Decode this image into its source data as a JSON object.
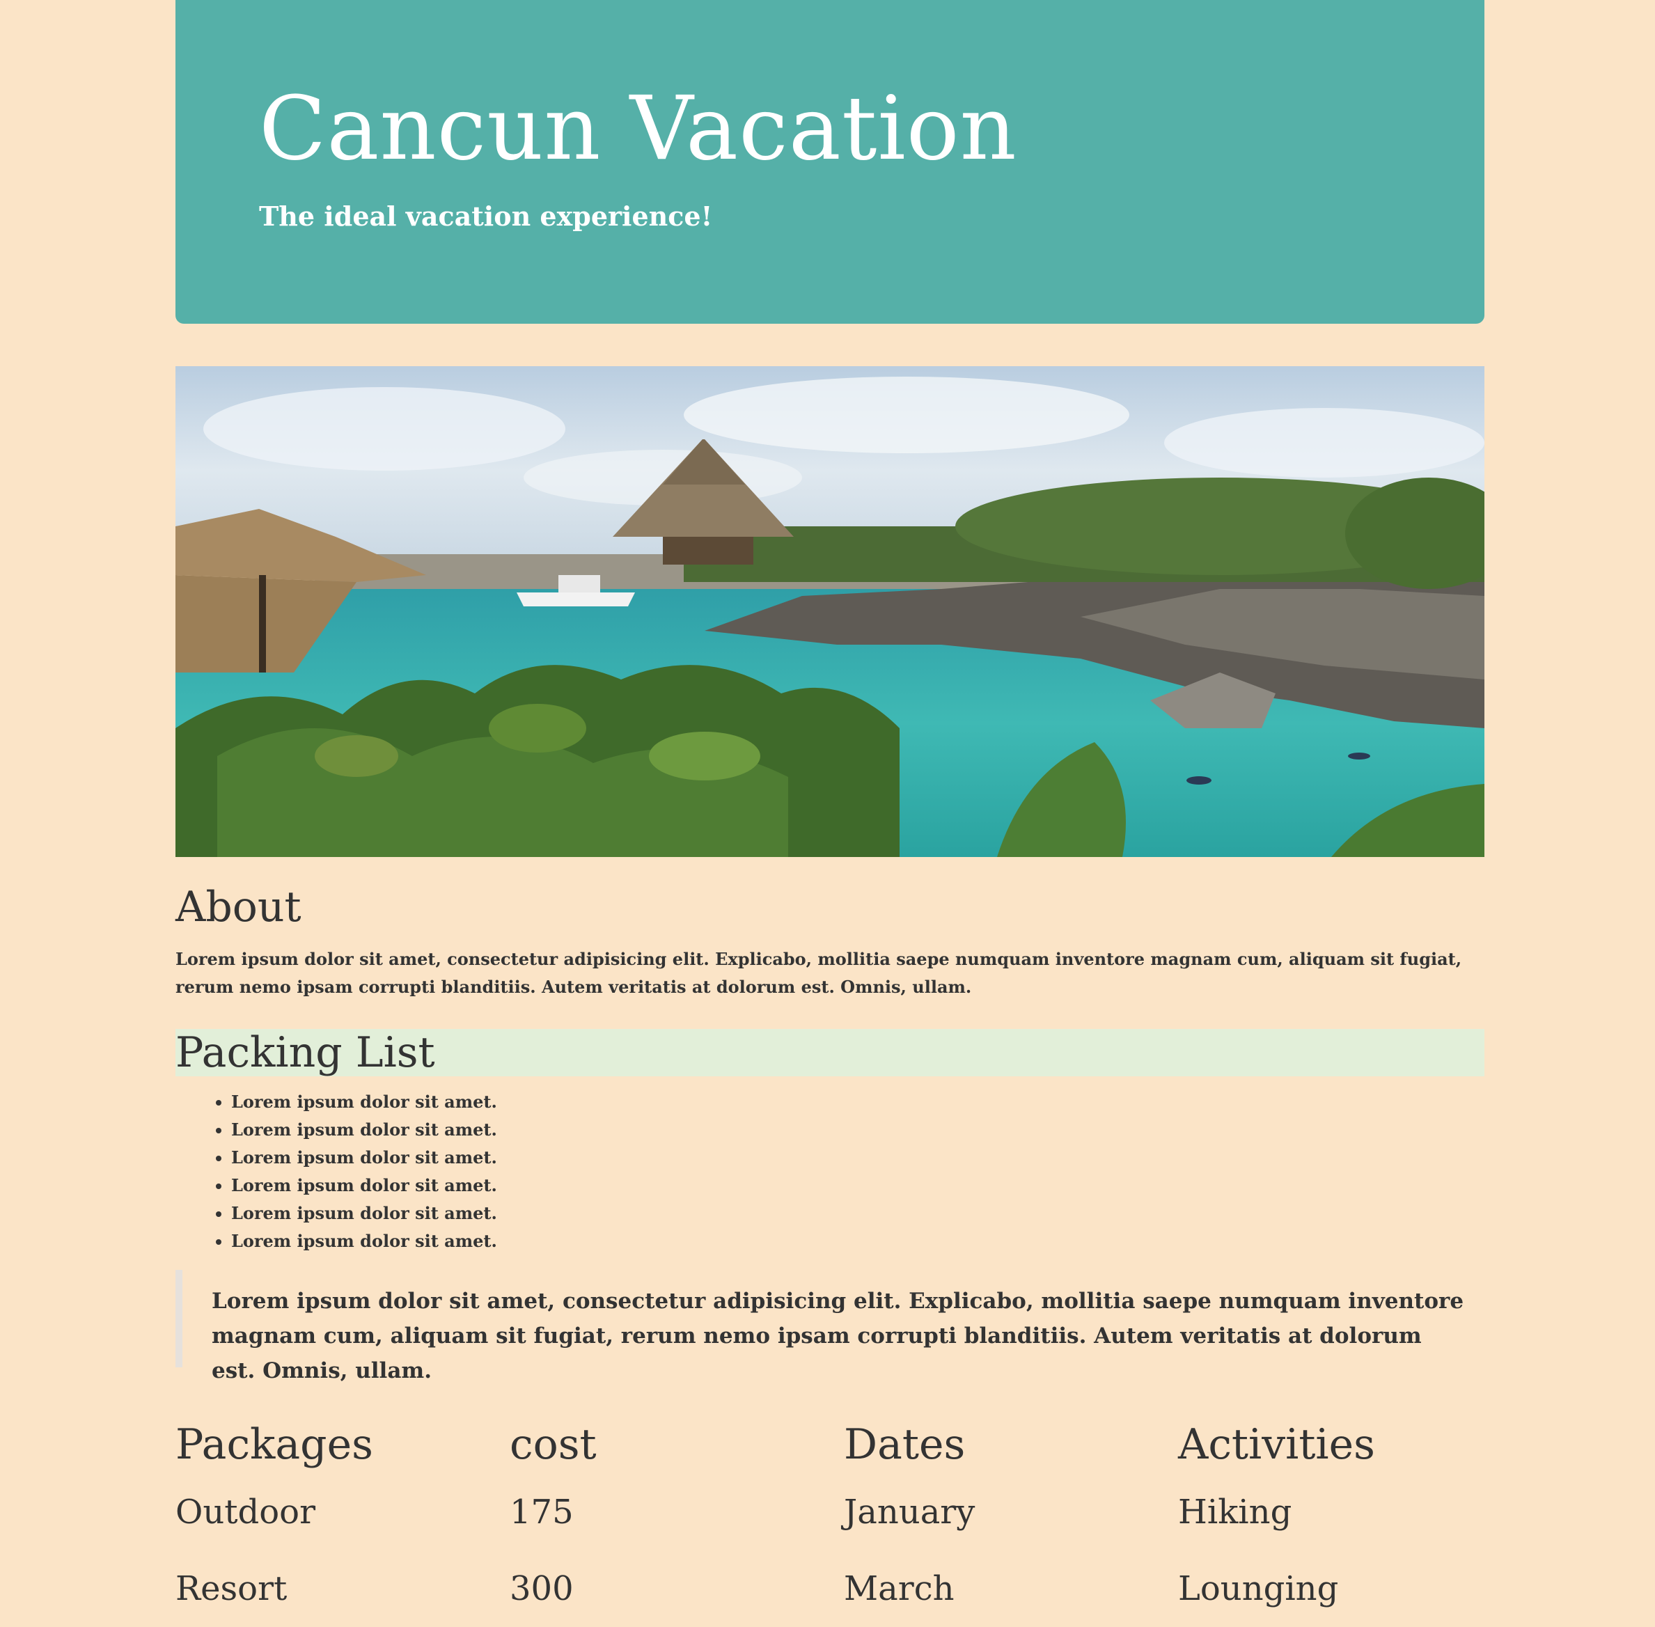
{
  "hero": {
    "title": "Cancun Vacation",
    "tagline": "The ideal vacation experience!"
  },
  "photo": {
    "alt": "resort lagoon with palapa huts and palm trees"
  },
  "about": {
    "title": "About",
    "text": "Lorem ipsum dolor sit amet, consectetur adipisicing elit. Explicabo, mollitia saepe numquam inventore magnam cum, aliquam sit fugiat, rerum nemo ipsam corrupti blanditiis. Autem veritatis at dolorum est. Omnis, ullam."
  },
  "packing": {
    "title": "Packing List",
    "items": [
      "Lorem ipsum dolor sit amet.",
      "Lorem ipsum dolor sit amet.",
      "Lorem ipsum dolor sit amet.",
      "Lorem ipsum dolor sit amet.",
      "Lorem ipsum dolor sit amet.",
      "Lorem ipsum dolor sit amet."
    ]
  },
  "quote": {
    "text": "Lorem ipsum dolor sit amet, consectetur adipisicing elit. Explicabo, mollitia saepe numquam inventore magnam cum, aliquam sit fugiat, rerum nemo ipsam corrupti blanditiis. Autem veritatis at dolorum est. Omnis, ullam."
  },
  "packages": {
    "headers": [
      "Packages",
      "cost",
      "Dates",
      "Activities"
    ],
    "rows": [
      [
        "Outdoor",
        "175",
        "January",
        "Hiking"
      ],
      [
        "Resort",
        "300",
        "March",
        "Lounging"
      ]
    ]
  },
  "colors": {
    "page_background": "#fbe4c7",
    "hero_background": "#55b0a8",
    "packing_band": "#e2efd9",
    "text": "#333333"
  }
}
